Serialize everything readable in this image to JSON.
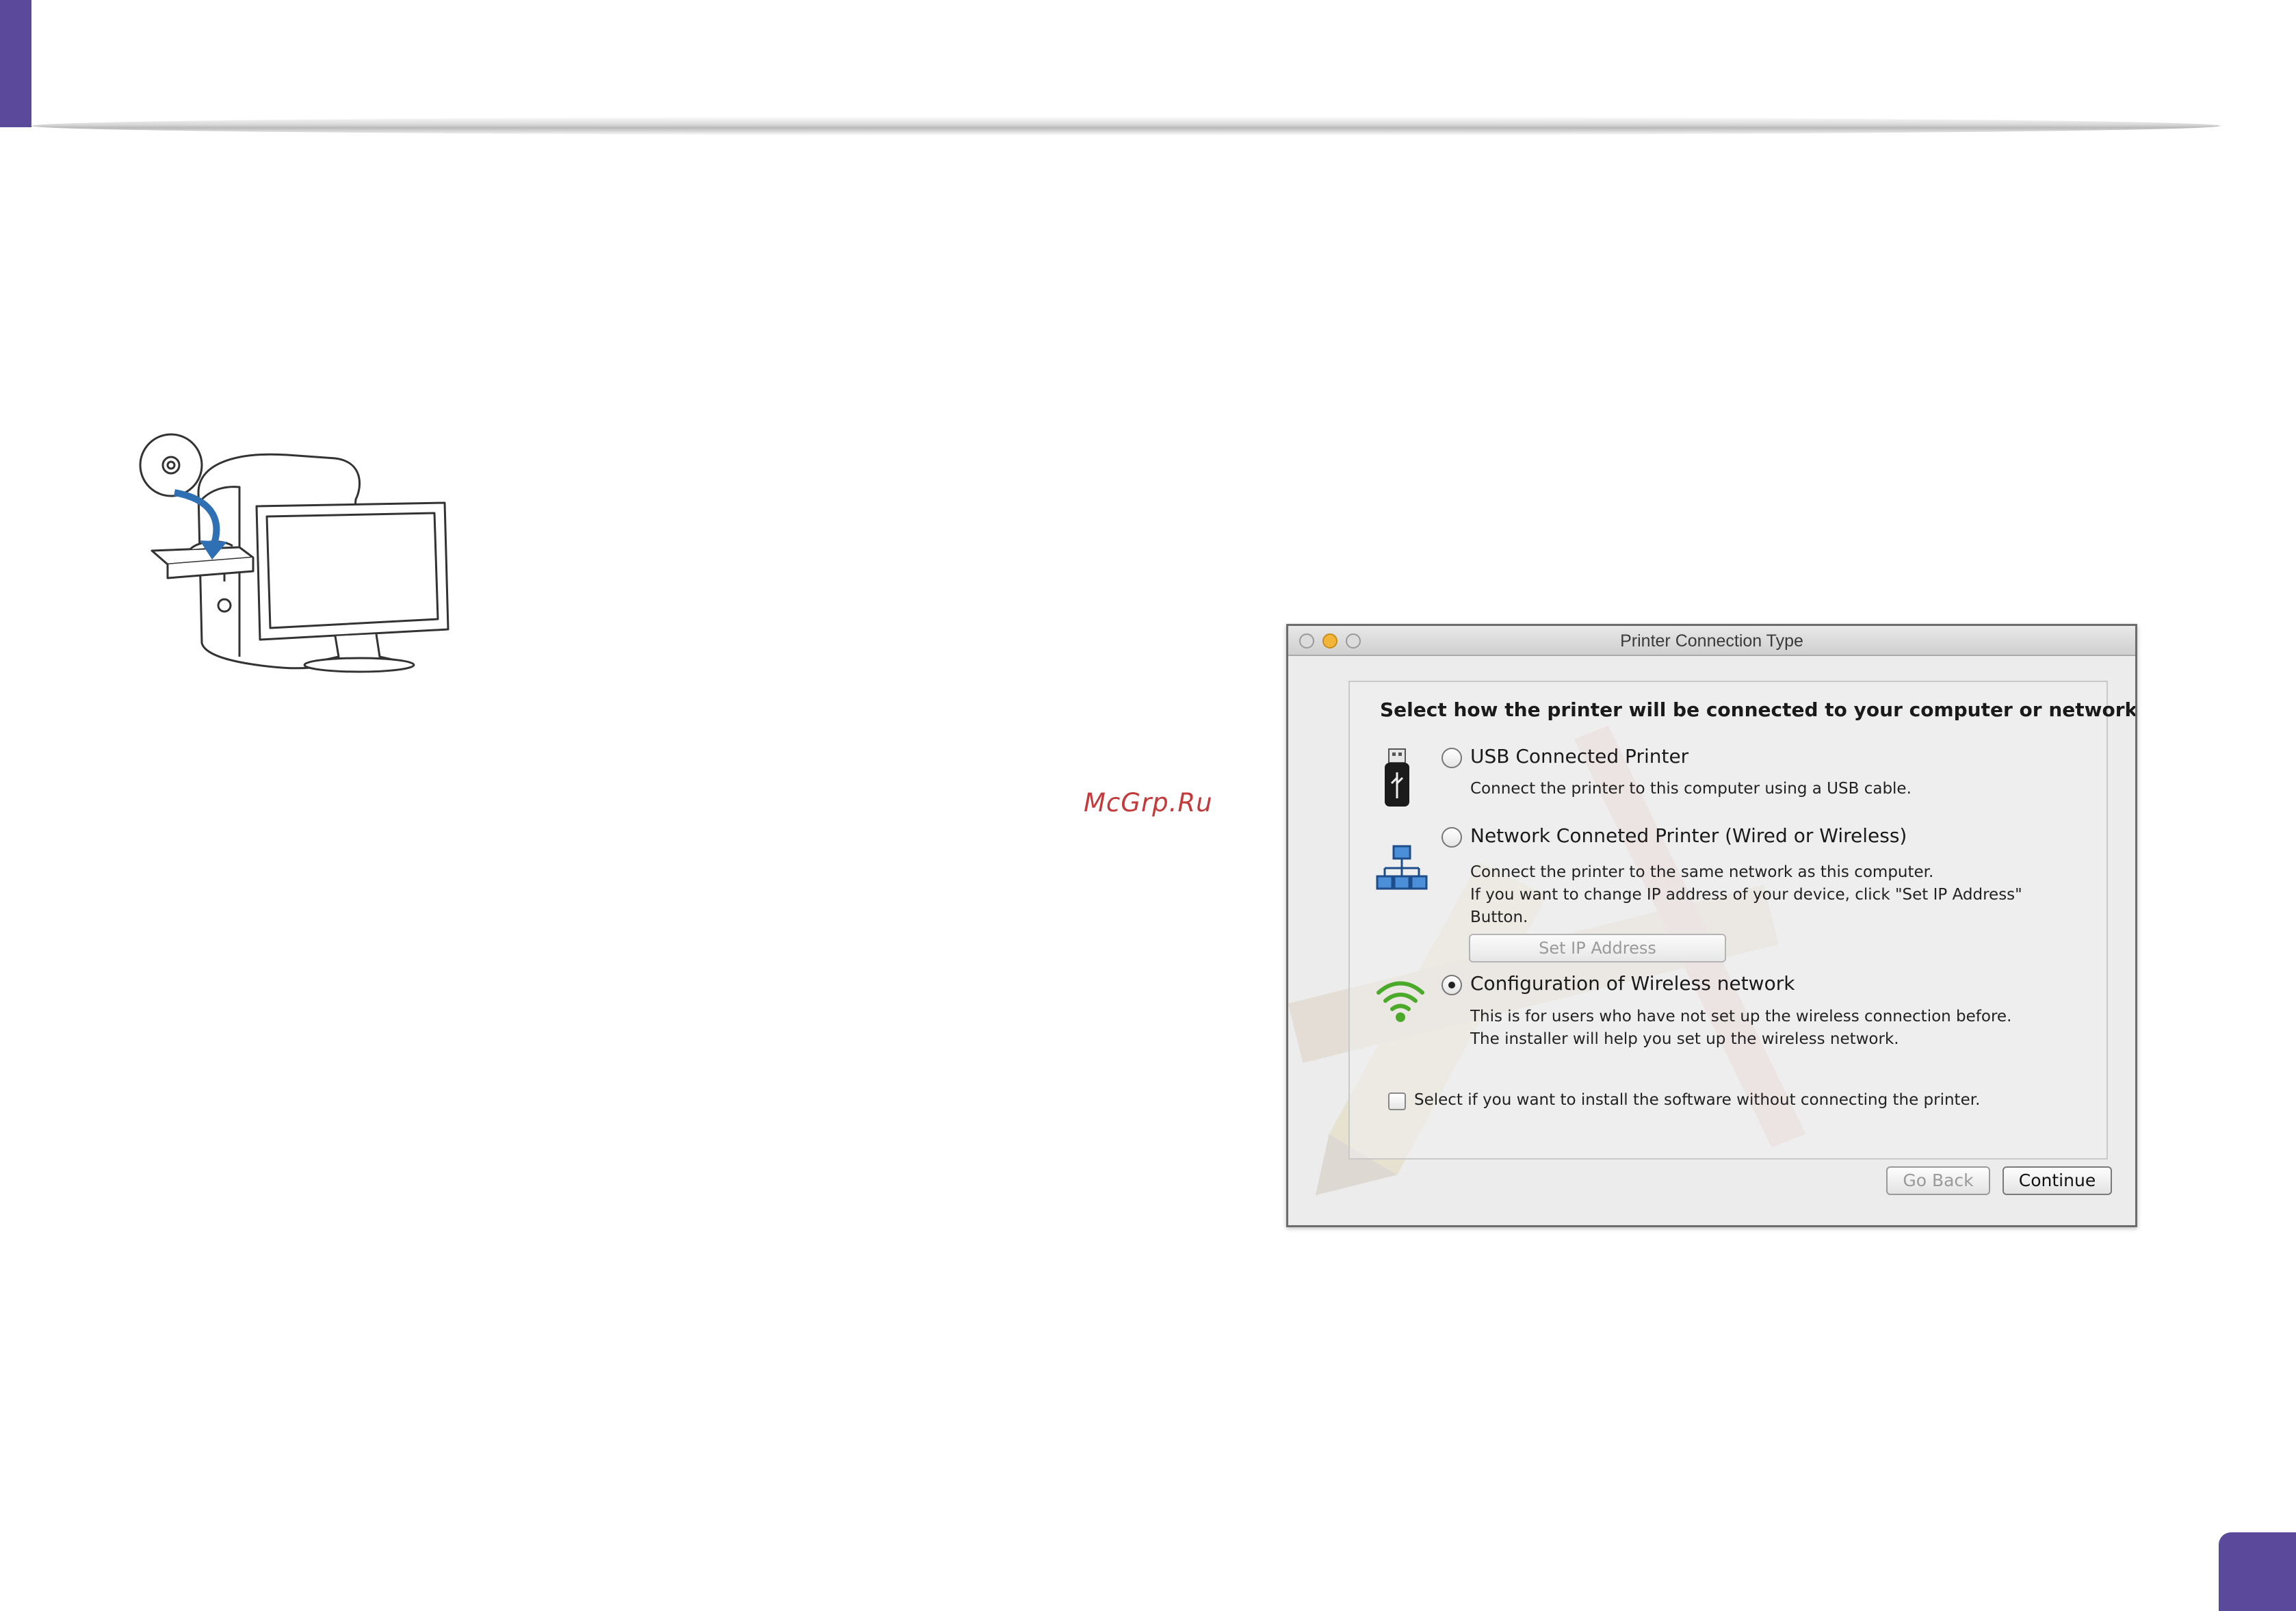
{
  "watermark": "McGrp.Ru",
  "illustration": {
    "icon": "computer-cd-install-icon"
  },
  "window": {
    "title": "Printer Connection Type",
    "heading": "Select how the printer will be connected to your computer or network.",
    "options": [
      {
        "label": "USB Connected Printer",
        "desc": [
          "Connect the printer to this computer using a USB cable."
        ],
        "icon": "usb-icon",
        "checked": false
      },
      {
        "label": "Network Conneted Printer (Wired or Wireless)",
        "desc": [
          "Connect the printer to the same network as this computer.",
          "If you want to change IP address of your device, click \"Set IP Address\"",
          "Button."
        ],
        "icon": "network-icon",
        "checked": false
      },
      {
        "label": "Configuration of Wireless network",
        "desc": [
          "This is for users who have not set up the wireless connection before.",
          "The installer will help you set up the wireless network."
        ],
        "icon": "wifi-icon",
        "checked": true
      }
    ],
    "set_ip_label": "Set IP Address",
    "checkbox_label": "Select if you want to install the software without connecting the printer.",
    "go_back_label": "Go Back",
    "continue_label": "Continue"
  },
  "colors": {
    "accent": "#5b4a9c",
    "watermark": "#c43a3a"
  }
}
